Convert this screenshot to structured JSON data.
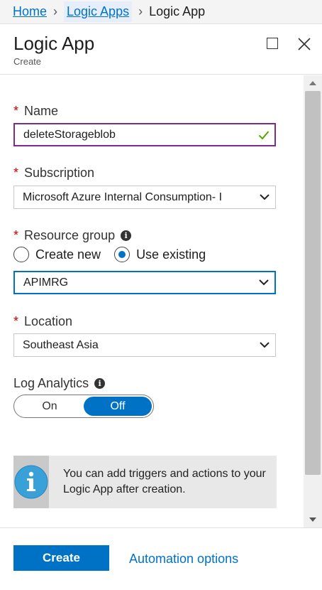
{
  "breadcrumb": {
    "items": [
      "Home",
      "Logic Apps"
    ],
    "current": "Logic App"
  },
  "blade": {
    "title": "Logic App",
    "subtitle": "Create"
  },
  "form": {
    "name": {
      "label": "Name",
      "value": "deleteStorageblob",
      "valid": true
    },
    "subscription": {
      "label": "Subscription",
      "value": "Microsoft Azure Internal Consumption- I"
    },
    "resource_group": {
      "label": "Resource group",
      "options": [
        "Create new",
        "Use existing"
      ],
      "selected": "Use existing",
      "value": "APIMRG"
    },
    "location": {
      "label": "Location",
      "value": "Southeast Asia"
    },
    "log_analytics": {
      "label": "Log Analytics",
      "options": [
        "On",
        "Off"
      ],
      "selected": "Off"
    }
  },
  "info_message": "You can add triggers and actions to your Logic App after creation.",
  "footer": {
    "create_label": "Create",
    "automation_label": "Automation options"
  },
  "colors": {
    "accent": "#0072c6",
    "required": "#cc0000",
    "valid_check": "#57a300",
    "name_border": "#7b2d8e"
  }
}
